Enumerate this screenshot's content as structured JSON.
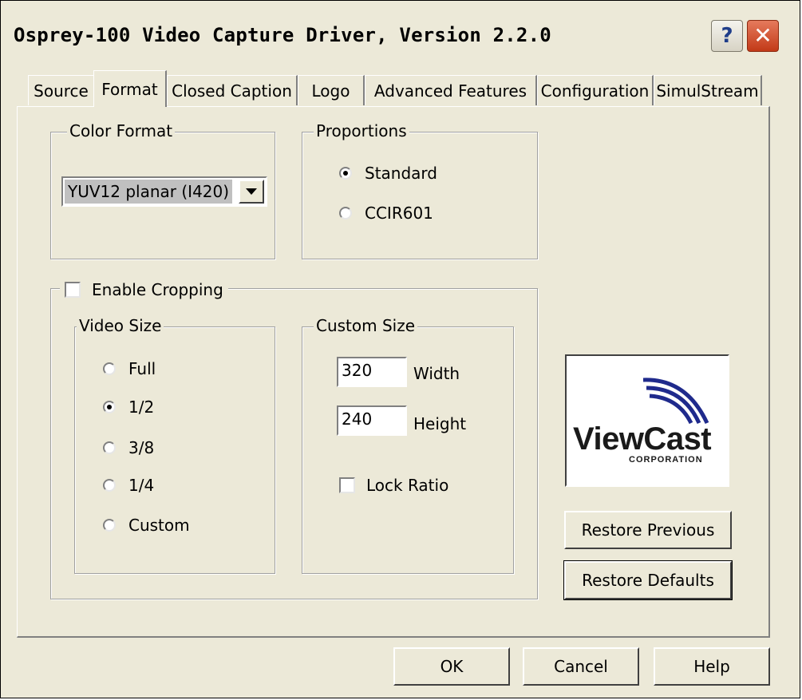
{
  "window": {
    "title": "Osprey-100 Video Capture Driver, Version 2.2.0"
  },
  "titlebar_buttons": {
    "help": "?",
    "close": "✕"
  },
  "tabs": [
    {
      "label": "Source"
    },
    {
      "label": "Format"
    },
    {
      "label": "Closed Caption"
    },
    {
      "label": "Logo"
    },
    {
      "label": "Advanced Features"
    },
    {
      "label": "Configuration"
    },
    {
      "label": "SimulStream"
    }
  ],
  "active_tab": "Format",
  "color_format": {
    "label": "Color Format",
    "selected": "YUV12 planar (I420)"
  },
  "proportions": {
    "label": "Proportions",
    "options": [
      {
        "label": "Standard",
        "checked": true
      },
      {
        "label": "CCIR601",
        "checked": false
      }
    ]
  },
  "cropping": {
    "label": "Enable Cropping",
    "checked": false
  },
  "video_size": {
    "label": "Video Size",
    "options": [
      {
        "label": "Full",
        "checked": false
      },
      {
        "label": "1/2",
        "checked": true
      },
      {
        "label": "3/8",
        "checked": false
      },
      {
        "label": "1/4",
        "checked": false
      },
      {
        "label": "Custom",
        "checked": false
      }
    ]
  },
  "custom_size": {
    "label": "Custom Size",
    "width_value": "320",
    "width_label": "Width",
    "height_value": "240",
    "height_label": "Height",
    "lock_ratio_label": "Lock Ratio",
    "lock_ratio_checked": false
  },
  "logo": {
    "wordmark": "ViewCast",
    "subtitle": "CORPORATION",
    "color": "#1f2a8c"
  },
  "buttons": {
    "restore_previous": "Restore Previous",
    "restore_defaults": "Restore Defaults",
    "ok": "OK",
    "cancel": "Cancel",
    "help": "Help"
  }
}
